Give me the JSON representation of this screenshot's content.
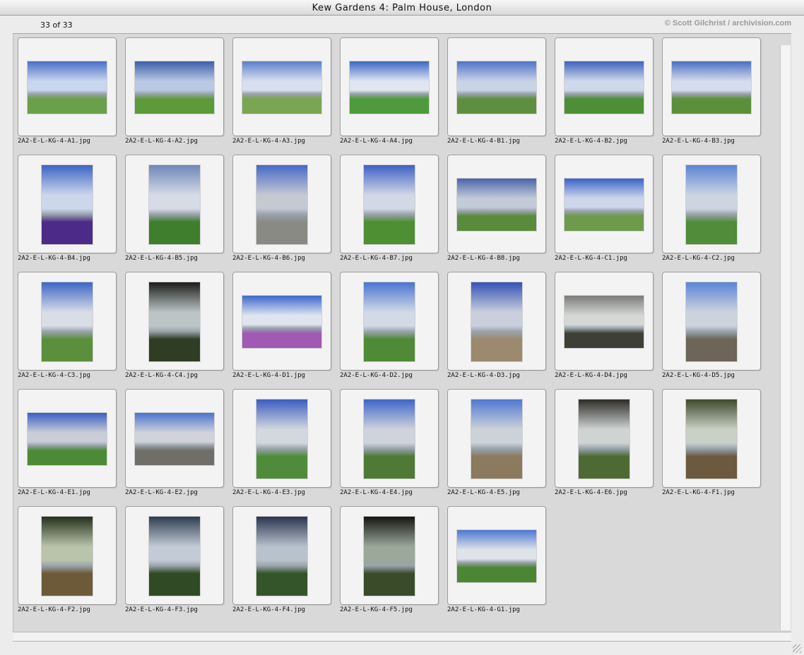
{
  "window": {
    "title": "Kew Gardens 4: Palm House, London"
  },
  "header": {
    "counter": "33 of 33",
    "credit": "© Scott Gilchrist / archivision.com"
  },
  "thumbnails": [
    {
      "file": "2A2-E-L-KG-4-A1.jpg",
      "orientation": "land",
      "palette": [
        "#4a6fc8",
        "#c8d6ee",
        "#6aa04a"
      ]
    },
    {
      "file": "2A2-E-L-KG-4-A2.jpg",
      "orientation": "land",
      "palette": [
        "#3b5fa8",
        "#b9c9e4",
        "#5c9a3a"
      ]
    },
    {
      "file": "2A2-E-L-KG-4-A3.jpg",
      "orientation": "land",
      "palette": [
        "#5b7fc9",
        "#d8e0ef",
        "#7aa552"
      ]
    },
    {
      "file": "2A2-E-L-KG-4-A4.jpg",
      "orientation": "land",
      "palette": [
        "#3e66c0",
        "#dfe6f2",
        "#4f9a3c"
      ]
    },
    {
      "file": "2A2-E-L-KG-4-B1.jpg",
      "orientation": "land",
      "palette": [
        "#4f73c7",
        "#c9d3e6",
        "#5d8f3e"
      ]
    },
    {
      "file": "2A2-E-L-KG-4-B2.jpg",
      "orientation": "land",
      "palette": [
        "#3d63b9",
        "#cfd9ec",
        "#4d8f36"
      ]
    },
    {
      "file": "2A2-E-L-KG-4-B3.jpg",
      "orientation": "land",
      "palette": [
        "#4a6fc1",
        "#d5dced",
        "#5b8f3a"
      ]
    },
    {
      "file": "2A2-E-L-KG-4-B4.jpg",
      "orientation": "port",
      "palette": [
        "#3c64c4",
        "#cdd7ec",
        "#4c2a88"
      ]
    },
    {
      "file": "2A2-E-L-KG-4-B5.jpg",
      "orientation": "port",
      "palette": [
        "#6e86b8",
        "#d6dbe6",
        "#3f7e2c"
      ]
    },
    {
      "file": "2A2-E-L-KG-4-B6.jpg",
      "orientation": "port",
      "palette": [
        "#4768c8",
        "#c5c9d2",
        "#8a8a84"
      ]
    },
    {
      "file": "2A2-E-L-KG-4-B7.jpg",
      "orientation": "port",
      "palette": [
        "#3f61c7",
        "#d2d8e5",
        "#4e8f34"
      ]
    },
    {
      "file": "2A2-E-L-KG-4-B8.jpg",
      "orientation": "land",
      "palette": [
        "#4a64a8",
        "#c3cbd9",
        "#5a8a3b"
      ]
    },
    {
      "file": "2A2-E-L-KG-4-C1.jpg",
      "orientation": "land",
      "palette": [
        "#3a63c9",
        "#cdd6ea",
        "#6e9a4c"
      ]
    },
    {
      "file": "2A2-E-L-KG-4-C2.jpg",
      "orientation": "port",
      "palette": [
        "#5b83d6",
        "#cdd5e1",
        "#508c3a"
      ]
    },
    {
      "file": "2A2-E-L-KG-4-C3.jpg",
      "orientation": "port",
      "palette": [
        "#3e65c6",
        "#d8dde6",
        "#5b8f3c"
      ]
    },
    {
      "file": "2A2-E-L-KG-4-C4.jpg",
      "orientation": "port",
      "palette": [
        "#1b1d18",
        "#bcc5c6",
        "#2f3d24"
      ]
    },
    {
      "file": "2A2-E-L-KG-4-D1.jpg",
      "orientation": "land",
      "palette": [
        "#3e68cd",
        "#dfe4ef",
        "#a05ab3"
      ]
    },
    {
      "file": "2A2-E-L-KG-4-D2.jpg",
      "orientation": "port",
      "palette": [
        "#4a75d0",
        "#d2dae6",
        "#4f8a36"
      ]
    },
    {
      "file": "2A2-E-L-KG-4-D3.jpg",
      "orientation": "port",
      "palette": [
        "#3552b5",
        "#c9cfdc",
        "#9b8a6e"
      ]
    },
    {
      "file": "2A2-E-L-KG-4-D4.jpg",
      "orientation": "land",
      "palette": [
        "#7b7c78",
        "#d6d8d6",
        "#3e4035"
      ]
    },
    {
      "file": "2A2-E-L-KG-4-D5.jpg",
      "orientation": "port",
      "palette": [
        "#5a84d8",
        "#cdd3dc",
        "#6c6558"
      ]
    },
    {
      "file": "2A2-E-L-KG-4-E1.jpg",
      "orientation": "land",
      "palette": [
        "#3a5ec2",
        "#c8cdd7",
        "#4c8a35"
      ]
    },
    {
      "file": "2A2-E-L-KG-4-E2.jpg",
      "orientation": "land",
      "palette": [
        "#4a73cf",
        "#d0d4da",
        "#6f6f68"
      ]
    },
    {
      "file": "2A2-E-L-KG-4-E3.jpg",
      "orientation": "port",
      "palette": [
        "#3b5dc0",
        "#d3d8df",
        "#4f8c3a"
      ]
    },
    {
      "file": "2A2-E-L-KG-4-E4.jpg",
      "orientation": "port",
      "palette": [
        "#3e66c9",
        "#cfd4dc",
        "#4e7a35"
      ]
    },
    {
      "file": "2A2-E-L-KG-4-E5.jpg",
      "orientation": "port",
      "palette": [
        "#4e78d4",
        "#cdd2d8",
        "#8b7a5e"
      ]
    },
    {
      "file": "2A2-E-L-KG-4-E6.jpg",
      "orientation": "port",
      "palette": [
        "#2e2d28",
        "#cfd3d2",
        "#4e6a34"
      ]
    },
    {
      "file": "2A2-E-L-KG-4-F1.jpg",
      "orientation": "port",
      "palette": [
        "#3f4a2c",
        "#c9d0c6",
        "#6b5a3e"
      ]
    },
    {
      "file": "2A2-E-L-KG-4-F2.jpg",
      "orientation": "port",
      "palette": [
        "#25301c",
        "#b9c4aa",
        "#6d5a38"
      ]
    },
    {
      "file": "2A2-E-L-KG-4-F3.jpg",
      "orientation": "port",
      "palette": [
        "#2d3d4f",
        "#c3ccd6",
        "#2f4a24"
      ]
    },
    {
      "file": "2A2-E-L-KG-4-F4.jpg",
      "orientation": "port",
      "palette": [
        "#2a3550",
        "#b8c2cc",
        "#34552a"
      ]
    },
    {
      "file": "2A2-E-L-KG-4-F5.jpg",
      "orientation": "port",
      "palette": [
        "#141611",
        "#9ba89a",
        "#3a4b2a"
      ]
    },
    {
      "file": "2A2-E-L-KG-4-G1.jpg",
      "orientation": "land",
      "palette": [
        "#4d78cf",
        "#dfe4ea",
        "#4c8634"
      ]
    }
  ]
}
